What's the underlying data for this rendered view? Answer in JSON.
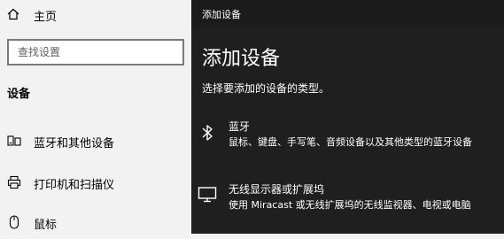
{
  "settings": {
    "home_label": "主页",
    "search_placeholder": "查找设置",
    "section_title": "设备",
    "items": [
      {
        "label": "蓝牙和其他设备",
        "icon": "devices-icon"
      },
      {
        "label": "打印机和扫描仪",
        "icon": "printer-icon"
      },
      {
        "label": "鼠标",
        "icon": "mouse-icon"
      }
    ]
  },
  "dialog": {
    "title": "添加设备",
    "heading": "添加设备",
    "prompt": "选择要添加的设备的类型。",
    "options": [
      {
        "name": "蓝牙",
        "desc": "鼠标、键盘、手写笔、音频设备以及其他类型的蓝牙设备",
        "icon": "bluetooth-icon"
      },
      {
        "name": "无线显示器或扩展坞",
        "desc": "使用 Miracast 或无线扩展坞的无线监视器、电视或电脑",
        "icon": "monitor-icon"
      }
    ]
  }
}
